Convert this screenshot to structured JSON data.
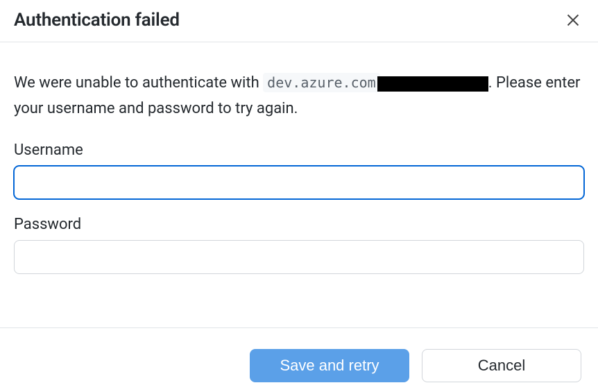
{
  "header": {
    "title": "Authentication failed"
  },
  "message": {
    "prefix": "We were unable to authenticate with ",
    "host": "dev.azure.com",
    "redacted": true,
    "suffix_after_redacted": ". Please enter your username and password to try again."
  },
  "fields": {
    "username": {
      "label": "Username",
      "value": ""
    },
    "password": {
      "label": "Password",
      "value": ""
    }
  },
  "buttons": {
    "primary": "Save and retry",
    "secondary": "Cancel"
  }
}
